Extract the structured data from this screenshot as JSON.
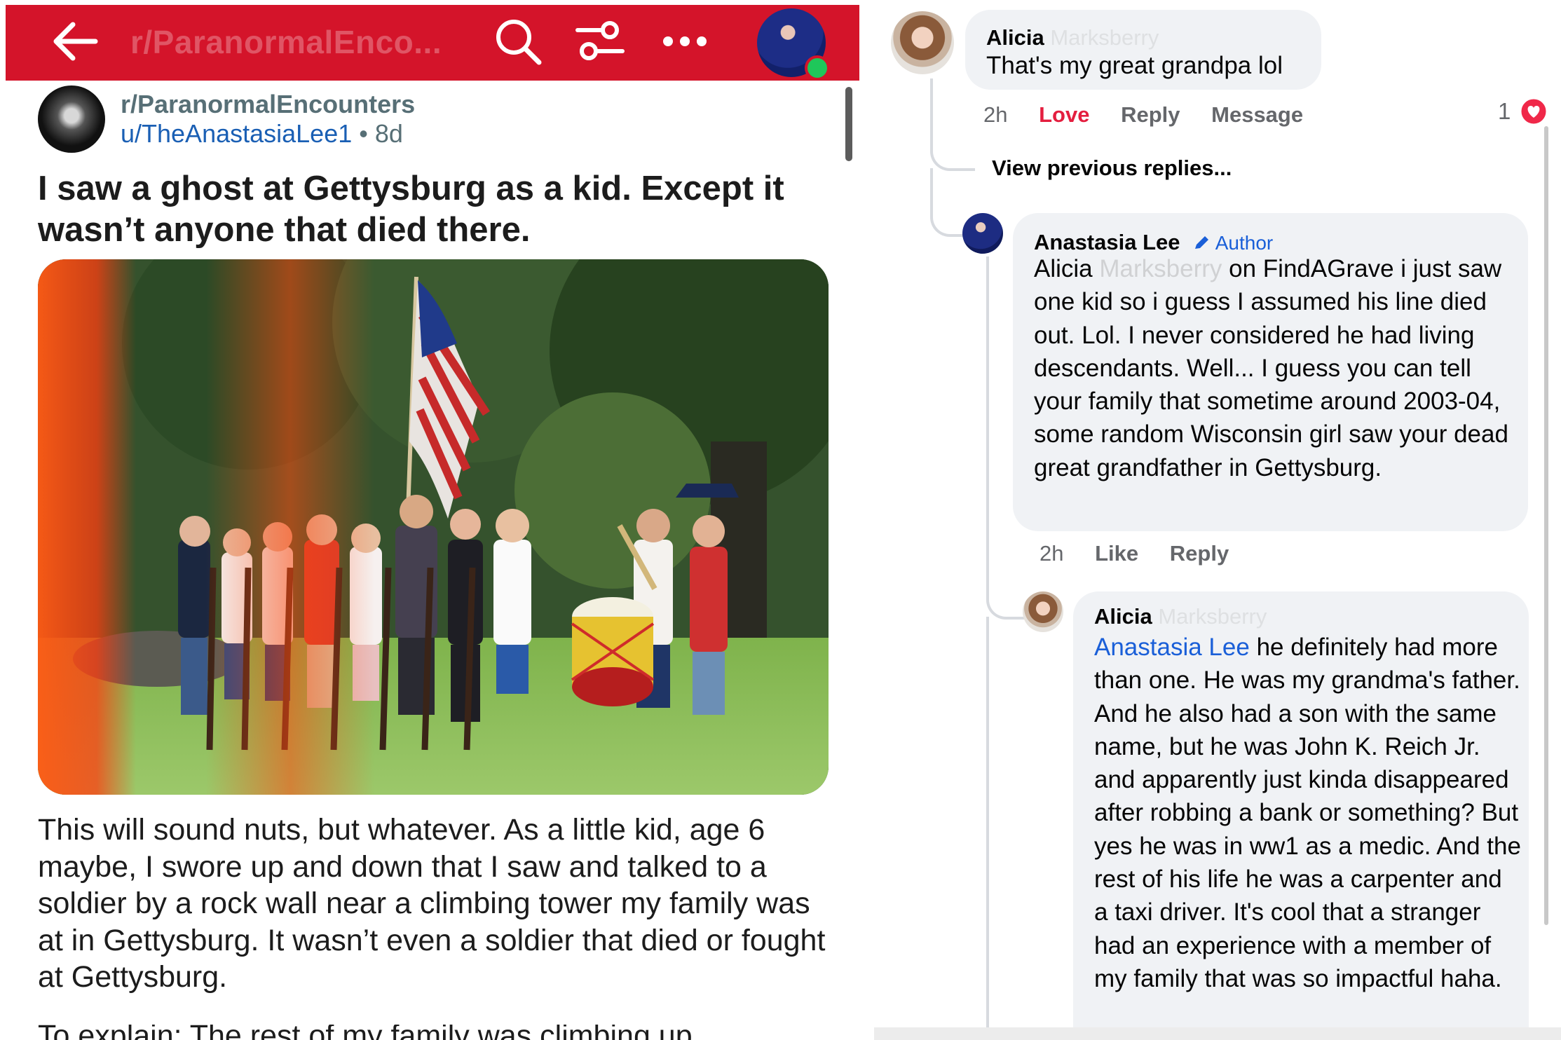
{
  "reddit": {
    "topbar": {
      "subreddit_faded": "r/ParanormalEnco...",
      "back_icon": "arrow-left-icon",
      "search_icon": "search-icon",
      "filter_icon": "filter-icon",
      "more_icon": "more-horizontal-icon",
      "accent_color": "#d4142a"
    },
    "post": {
      "subreddit": "r/ParanormalEncounters",
      "username": "u/TheAnastasiaLee1",
      "separator": "•",
      "age": "8d",
      "title": "I saw a ghost at Gettysburg as a kid. Except it wasn’t anyone that died there.",
      "body": "This will sound nuts, but whatever. As a little kid, age 6 maybe, I swore up and down that I saw and talked to a soldier by a rock wall near a climbing tower my family was at in Gettysburg. It wasn’t even a soldier that died or fought at Gettysburg.",
      "body_cut": "To explain: The rest of my family was climbing up"
    }
  },
  "facebook": {
    "comment1": {
      "name": "Alicia",
      "name_blurred": "Marksberry",
      "text": "That's my great grandpa lol",
      "time": "2h",
      "love_label": "Love",
      "reply_label": "Reply",
      "message_label": "Message",
      "reaction_count": "1",
      "reaction_icon": "heart-icon"
    },
    "view_previous": "View previous replies...",
    "comment2": {
      "name": "Anastasia Lee",
      "author_label": "Author",
      "author_icon": "pencil-icon",
      "mention": "Alicia",
      "mention_blurred": "Marksberry",
      "text": "on FindAGrave i just saw one kid so i guess I assumed his line died out. Lol. I never considered he had living descendants. Well... I guess you can tell your family that sometime around 2003-04, some random Wisconsin girl saw your dead great grandfather in Gettysburg.",
      "time": "2h",
      "like_label": "Like",
      "reply_label": "Reply"
    },
    "comment3": {
      "name": "Alicia",
      "name_blurred": "Marksberry",
      "mention": "Anastasia Lee",
      "text": "he definitely had more than one. He was my grandma's father. And he also had a son with the same name, but he was John K. Reich Jr. and apparently just kinda disappeared after robbing a bank or something? But yes he was in ww1 as a medic. And the rest of his life he was a carpenter and a taxi driver. It's cool that a stranger had an experience with a member of my family that was so impactful haha."
    }
  }
}
